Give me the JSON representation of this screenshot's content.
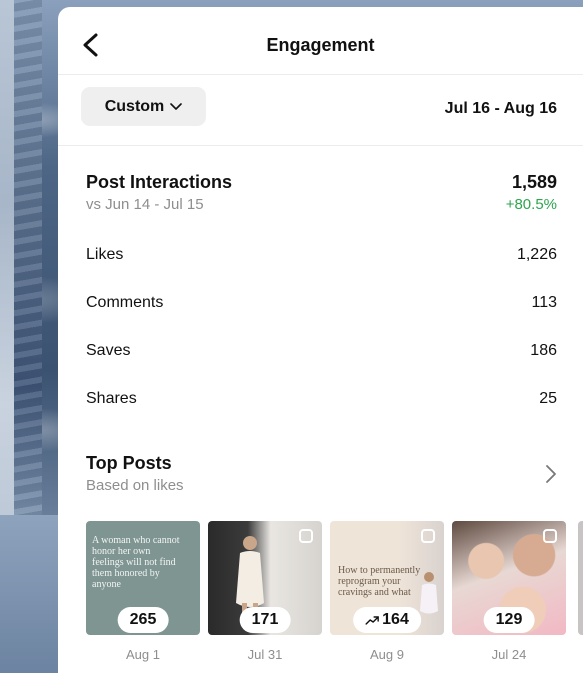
{
  "header": {
    "title": "Engagement"
  },
  "filter": {
    "custom_label": "Custom",
    "date_range": "Jul 16 - Aug 16"
  },
  "interactions": {
    "title": "Post Interactions",
    "compare": "vs Jun 14 - Jul 15",
    "total": "1,589",
    "change": "+80.5%",
    "change_color": "#2ea44f",
    "metrics": [
      {
        "label": "Likes",
        "value": "1,226"
      },
      {
        "label": "Comments",
        "value": "113"
      },
      {
        "label": "Saves",
        "value": "186"
      },
      {
        "label": "Shares",
        "value": "25"
      }
    ]
  },
  "top_posts": {
    "title": "Top Posts",
    "subtitle": "Based on likes",
    "posts": [
      {
        "count": "265",
        "date": "Aug 1",
        "caption": "A woman who cannot honor her own feelings will not find them honored by anyone",
        "trending": false
      },
      {
        "count": "171",
        "date": "Jul 31",
        "caption": "",
        "trending": false
      },
      {
        "count": "164",
        "date": "Aug 9",
        "caption": "How to permanently reprogram your cravings and what",
        "trending": true
      },
      {
        "count": "129",
        "date": "Jul 24",
        "caption": "",
        "trending": false
      }
    ]
  },
  "icons": {
    "back": "chevron-left-icon",
    "dropdown": "chevron-down-icon",
    "more": "chevron-right-icon",
    "trend": "trending-up-icon",
    "multi": "carousel-icon"
  }
}
